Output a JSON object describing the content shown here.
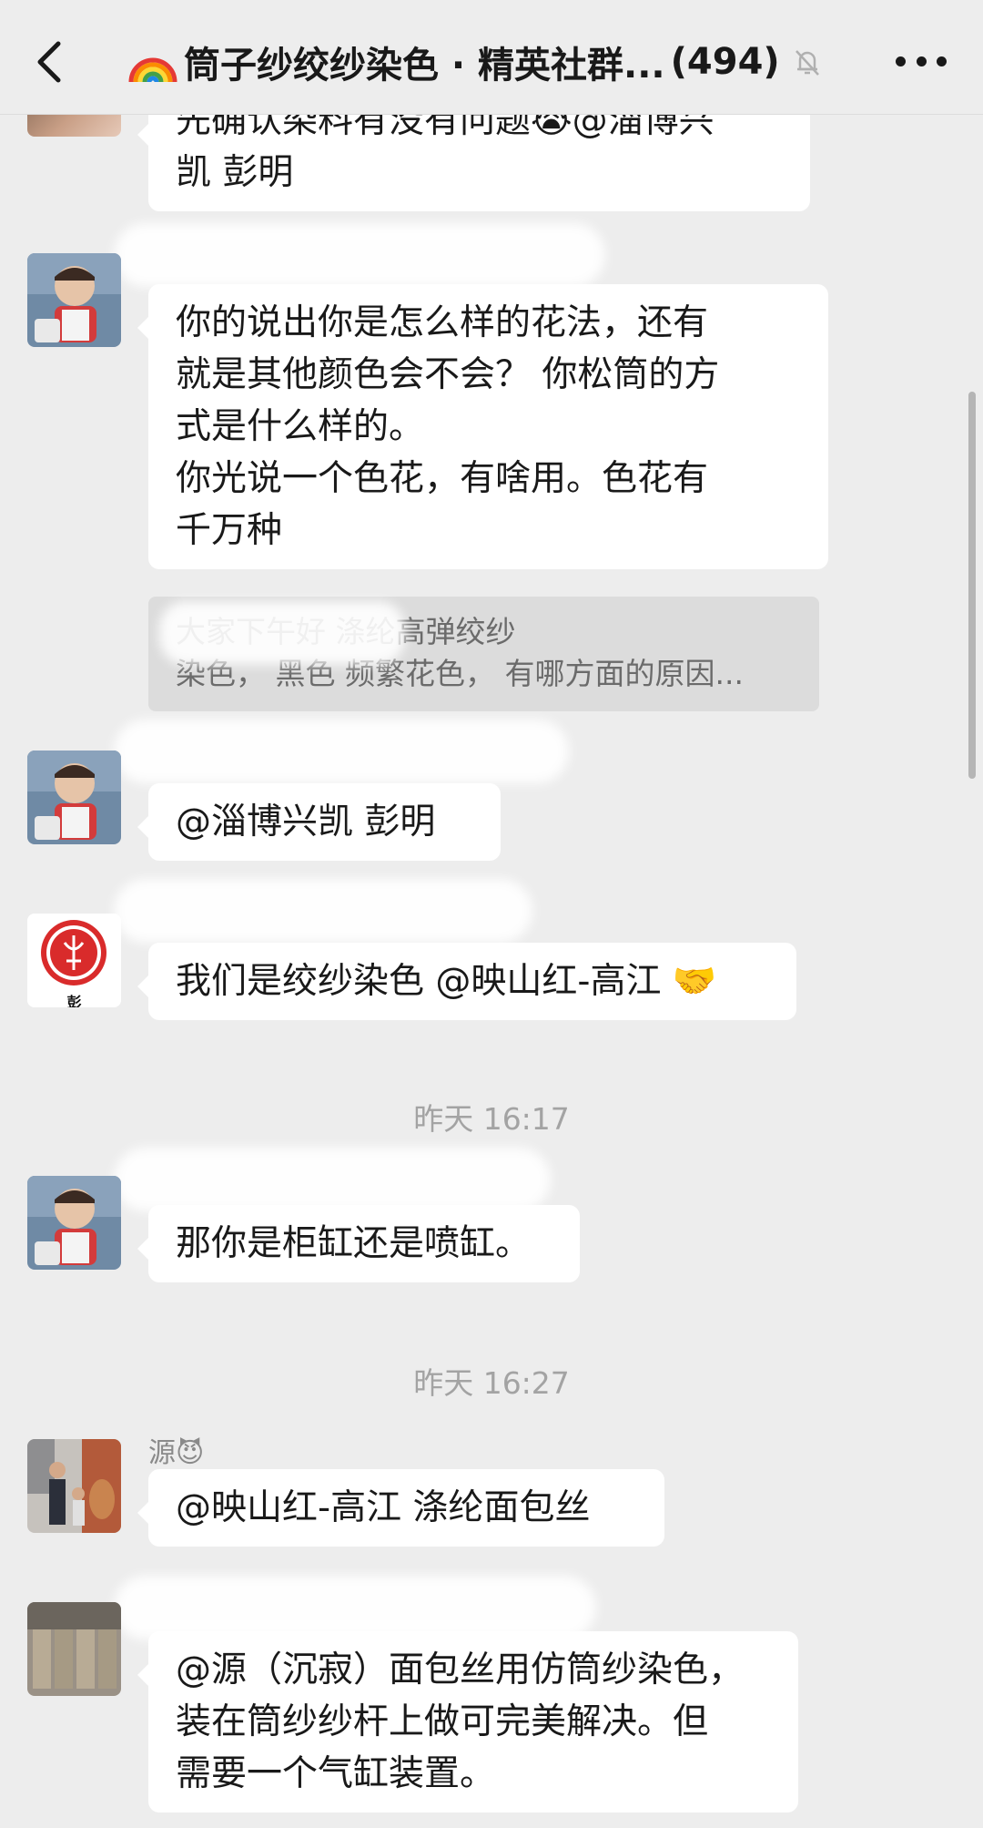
{
  "header": {
    "title": "筒子纱绞纱染色 · 精英社群...",
    "member_count": "(494)",
    "icons": [
      "back-arrow-icon",
      "rainbow-emoji-icon",
      "mute-bell-icon",
      "more-dots-icon"
    ]
  },
  "messages": [
    {
      "id": "m0",
      "lines": [
        "先确认染料有没有问题😭@淄博兴",
        "凯 彭明"
      ]
    },
    {
      "id": "m1",
      "lines": [
        "你的说出你是怎么样的花法，还有",
        "就是其他颜色会不会？  你松筒的方",
        "式是什么样的。",
        "  你光说一个色花，有啥用。色花有",
        "千万种"
      ],
      "quote": {
        "lines": [
          "                大家下午好  涤纶高弹绞纱",
          "染色， 黑色 频繁花色， 有哪方面的原因..."
        ]
      }
    },
    {
      "id": "m2",
      "lines": [
        "@淄博兴凯 彭明"
      ]
    },
    {
      "id": "m3",
      "avatar_caption": "彭",
      "lines": [
        "我们是绞纱染色 @映山红-高江 🤝"
      ]
    },
    {
      "id": "ts1",
      "timestamp": "昨天 16:17"
    },
    {
      "id": "m4",
      "lines": [
        "那你是柜缸还是喷缸。"
      ]
    },
    {
      "id": "ts2",
      "timestamp": "昨天 16:27"
    },
    {
      "id": "m5",
      "nickname": "源😈",
      "lines": [
        "@映山红-高江 涤纶面包丝"
      ]
    },
    {
      "id": "m6",
      "lines": [
        "@源（沉寂）面包丝用仿筒纱染色，",
        "装在筒纱纱杆上做可完美解决。但",
        "需要一个气缸装置。"
      ]
    }
  ],
  "colors": {
    "background": "#ededed",
    "bubble": "#ffffff",
    "quote": "#dcdcdc",
    "timestamp": "#a3a3a3"
  }
}
